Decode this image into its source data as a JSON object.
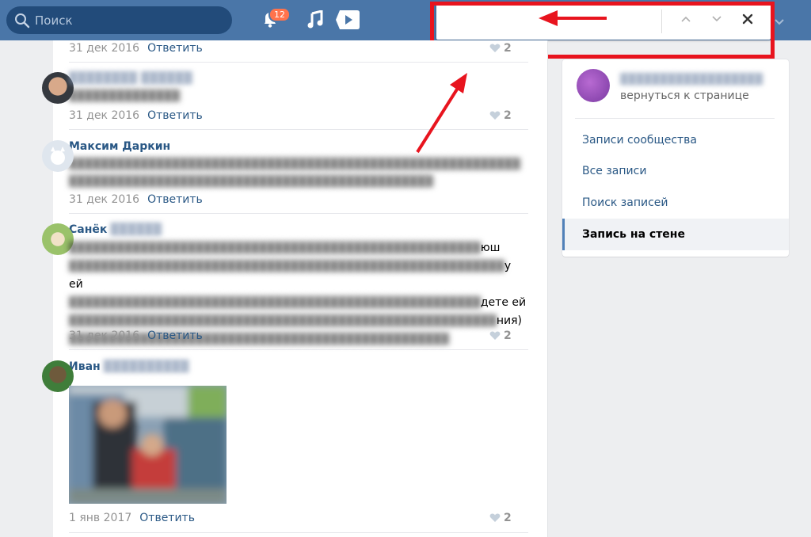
{
  "header": {
    "search_placeholder": "Поиск",
    "notifications_count": "12",
    "icons": [
      "search-icon",
      "bell-icon",
      "music-icon",
      "video-icon",
      "chevron-down-icon"
    ]
  },
  "findbar": {
    "value": "",
    "icons": [
      "chevron-up-icon",
      "chevron-down-icon",
      "close-icon"
    ]
  },
  "comments": [
    {
      "author": "",
      "text": "",
      "date": "31 дек 2016",
      "reply": "Ответить",
      "likes": "2"
    },
    {
      "author": "",
      "text": "",
      "date": "31 дек 2016",
      "reply": "Ответить",
      "likes": "2"
    },
    {
      "author": "Максим Даркин",
      "text": "",
      "date": "31 дек 2016",
      "reply": "Ответить",
      "likes": "2"
    },
    {
      "author": "Санёк",
      "text_tails": [
        "юш",
        "у ей",
        "дете ей",
        "ния)"
      ],
      "date": "31 дек 2016",
      "reply": "Ответить",
      "likes": "2"
    },
    {
      "author": "Иван",
      "date": "1 янв 2017",
      "reply": "Ответить",
      "likes": "2"
    }
  ],
  "sidebar": {
    "back_label": "вернуться к странице",
    "items": [
      {
        "label": "Записи сообщества",
        "active": false
      },
      {
        "label": "Все записи",
        "active": false
      },
      {
        "label": "Поиск записей",
        "active": false
      },
      {
        "label": "Запись на стене",
        "active": true
      }
    ]
  },
  "colors": {
    "header_bg": "#4a76a8",
    "link": "#2a5885",
    "highlight": "#e8141e",
    "badge": "#ff734c"
  }
}
